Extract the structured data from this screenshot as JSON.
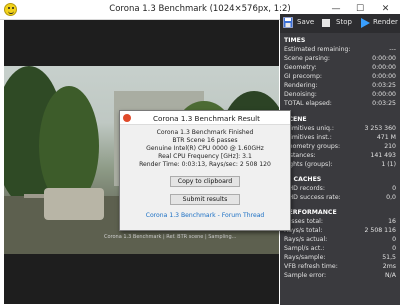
{
  "window": {
    "title": "Corona 1.3 Benchmark (1024×576px, 1:2)",
    "min_glyph": "—",
    "max_glyph": "☐",
    "close_glyph": "✕"
  },
  "toolbar": {
    "save_label": "Save",
    "stop_label": "Stop",
    "render_label": "Render"
  },
  "render": {
    "statusline": "Corona 1.3 Benchmark | Ref. BTR scene | Sampling..."
  },
  "stats": {
    "times": {
      "header": "TIMES",
      "rows": [
        {
          "k": "Estimated remaining:",
          "v": "---"
        },
        {
          "k": "Scene parsing:",
          "v": "0:00:00"
        },
        {
          "k": "Geometry:",
          "v": "0:00:00"
        },
        {
          "k": "GI precomp:",
          "v": "0:00:00"
        },
        {
          "k": "Rendering:",
          "v": "0:03:25"
        },
        {
          "k": "Denoising:",
          "v": "0:00:00"
        },
        {
          "k": "TOTAL elapsed:",
          "v": "0:03:25"
        }
      ]
    },
    "scene": {
      "header": "SCENE",
      "rows": [
        {
          "k": "Primitives uniq.:",
          "v": "3 253 360"
        },
        {
          "k": "Primitives inst.:",
          "v": "471 M"
        },
        {
          "k": "Geometry groups:",
          "v": "210"
        },
        {
          "k": "Instances:",
          "v": "141 493"
        },
        {
          "k": "Lights (groups):",
          "v": "1 (1)"
        }
      ]
    },
    "caches": {
      "header": "GI CACHES",
      "rows": [
        {
          "k": "UHD records:",
          "v": "0"
        },
        {
          "k": "UHD success rate:",
          "v": "0,0"
        }
      ]
    },
    "performance": {
      "header": "PERFORMANCE",
      "rows": [
        {
          "k": "Passes total:",
          "v": "16"
        },
        {
          "k": "Rays/s total:",
          "v": "2 508 116"
        },
        {
          "k": "Rays/s actual:",
          "v": "0"
        },
        {
          "k": "Sampl/s act.:",
          "v": "0"
        },
        {
          "k": "Rays/sample:",
          "v": "51,5"
        },
        {
          "k": "VFB refresh time:",
          "v": "2ms"
        },
        {
          "k": "Sample error:",
          "v": "N/A"
        }
      ]
    }
  },
  "dialog": {
    "title": "Corona 1.3 Benchmark Result",
    "lines": [
      "Corona 1.3 Benchmark Finished",
      "BTR Scene 16 passes",
      "Genuine Intel(R) CPU 0000 @ 1.60GHz",
      "Real CPU Frequency [GHz]: 3.1",
      "Render Time: 0:03:13, Rays/sec: 2 508 120"
    ],
    "copy_button": "Copy to clipboard",
    "submit_button": "Submit results",
    "link": "Corona 1.3 Benchmark - Forum Thread"
  }
}
